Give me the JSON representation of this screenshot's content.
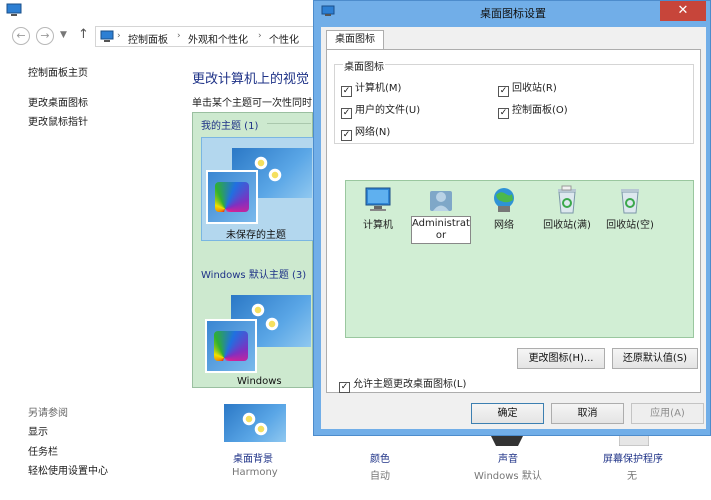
{
  "address": {
    "crumbs": [
      "控制面板",
      "外观和个性化",
      "个性化"
    ]
  },
  "left_nav": {
    "home": "控制面板主页",
    "links": [
      "更改桌面图标",
      "更改鼠标指针"
    ],
    "see_also_title": "另请参阅",
    "see_also": [
      "显示",
      "任务栏",
      "轻松使用设置中心"
    ]
  },
  "main": {
    "title": "更改计算机上的视觉",
    "description": "单击某个主题可一次性同时"
  },
  "themes": {
    "my_themes_title": "我的主题 (1)",
    "unsaved_label": "未保存的主题",
    "default_title": "Windows 默认主题 (3)",
    "windows_label": "Windows"
  },
  "bottom_strip": [
    {
      "label": "桌面背景",
      "value": "Harmony"
    },
    {
      "label": "颜色",
      "value": "自动"
    },
    {
      "label": "声音",
      "value": "Windows 默认"
    },
    {
      "label": "屏幕保护程序",
      "value": "无"
    }
  ],
  "dialog": {
    "title": "桌面图标设置",
    "close_glyph": "✕",
    "tab": "桌面图标",
    "group_title": "桌面图标",
    "checkmark": "✓",
    "checkboxes": [
      {
        "label": "计算机(M)",
        "checked": true
      },
      {
        "label": "回收站(R)",
        "checked": true
      },
      {
        "label": "用户的文件(U)",
        "checked": true
      },
      {
        "label": "控制面板(O)",
        "checked": true
      },
      {
        "label": "网络(N)",
        "checked": true
      }
    ],
    "icons": [
      {
        "label": "计算机",
        "icon": "computer-icon"
      },
      {
        "label": "Administrator",
        "icon": "user-folder-icon"
      },
      {
        "label": "网络",
        "icon": "network-icon"
      },
      {
        "label": "回收站(满)",
        "icon": "recycle-bin-full-icon"
      },
      {
        "label": "回收站(空)",
        "icon": "recycle-bin-empty-icon"
      }
    ],
    "change_icon_button": "更改图标(H)...",
    "restore_default_button": "还原默认值(S)",
    "allow_themes_label": "允许主题更改桌面图标(L)",
    "allow_themes_checked": true,
    "ok_button": "确定",
    "cancel_button": "取消",
    "apply_button": "应用(A)"
  },
  "colors": {
    "accent_blue": "#1e3287",
    "dialog_frame": "#71aee8",
    "close_red": "#c7453a",
    "green_panel": "#d1eed4"
  }
}
